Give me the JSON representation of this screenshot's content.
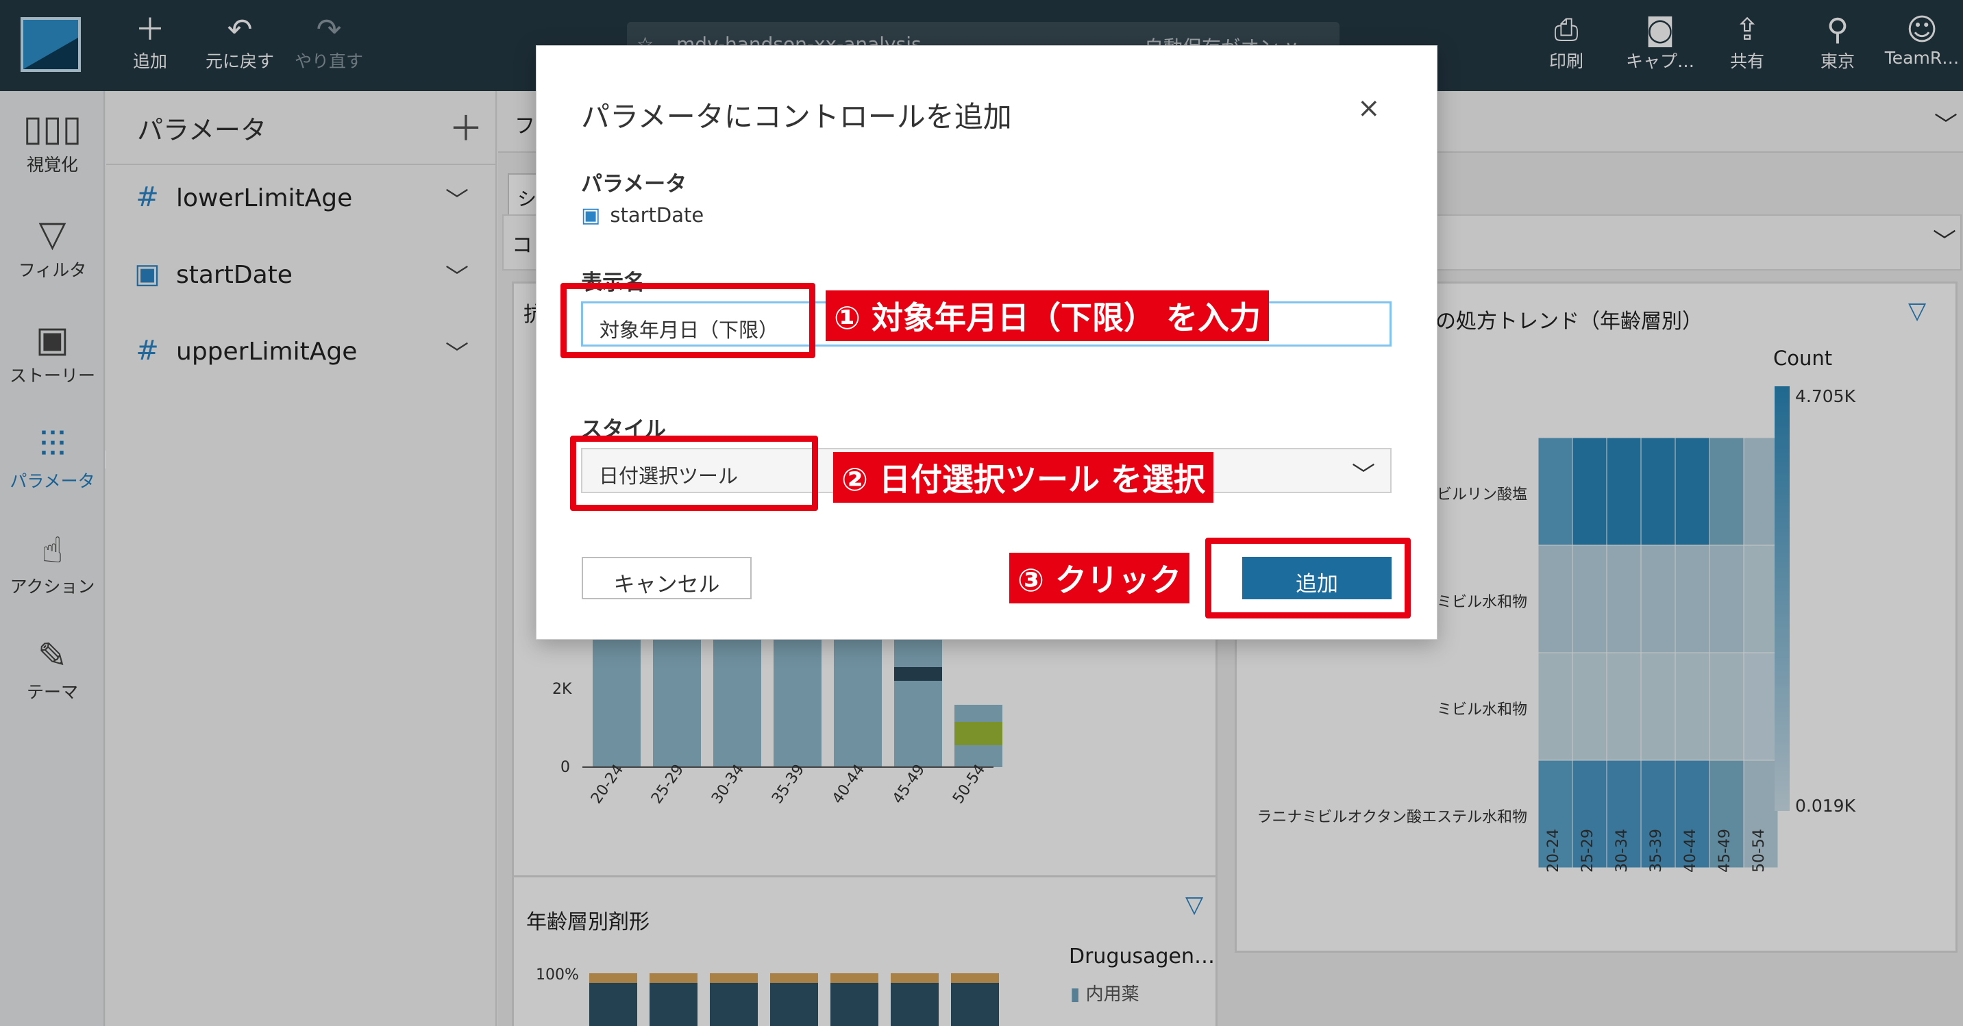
{
  "toolbar": {
    "add": "追加",
    "undo": "元に戻す",
    "redo": "やり直す",
    "analysis_name": "mdv-handson-xx-analysis",
    "autosave": "自動保存がオン ∨",
    "print": "印刷",
    "capture": "キャプ…",
    "share": "共有",
    "region": "東京",
    "user": "TeamR…"
  },
  "rail": {
    "items": [
      {
        "label": "視覚化",
        "icon": "bar-chart-icon"
      },
      {
        "label": "フィルタ",
        "icon": "filter-icon"
      },
      {
        "label": "ストーリー",
        "icon": "story-icon"
      },
      {
        "label": "パラメータ",
        "icon": "sliders-icon"
      },
      {
        "label": "アクション",
        "icon": "click-gear-icon"
      },
      {
        "label": "テーマ",
        "icon": "brush-icon"
      }
    ]
  },
  "params_panel": {
    "title": "パラメータ",
    "items": [
      {
        "name": "lowerLimitAge",
        "type": "number"
      },
      {
        "name": "startDate",
        "type": "date"
      },
      {
        "name": "upperLimitAge",
        "type": "number"
      }
    ]
  },
  "main": {
    "band1_text": "フ",
    "sheet_tab": "シ",
    "control_bar_text": "コ",
    "visual1_title": "抗",
    "visual2_title": "の処方トレンド（年齢層別）",
    "visual3_title": "年齢層別剤形",
    "legend3_title": "Drugusagen…",
    "legend3_item": "内用薬",
    "heat_count_label": "Count",
    "heat_max": "4.705K",
    "heat_min": "0.019K",
    "heat_rows": [
      "ビルリン酸塩",
      "ミビル水和物",
      "ミビル水和物",
      "ラニナミビルオクタン酸エステル水和物"
    ],
    "age_bins": [
      "20-24",
      "25-29",
      "30-34",
      "35-39",
      "40-44",
      "45-49",
      "50-54"
    ],
    "y_ticks_v1": [
      "2K",
      "0"
    ],
    "y_tick_v3": "100%"
  },
  "dialog": {
    "title": "パラメータにコントロールを追加",
    "param_label": "パラメータ",
    "param_value": "startDate",
    "display_name_label": "表示名",
    "display_name_value": "対象年月日（下限）",
    "style_label": "スタイル",
    "style_value": "日付選択ツール",
    "cancel": "キャンセル",
    "add": "追加"
  },
  "annotations": {
    "step1": "① 対象年月日（下限） を入力",
    "step2": "② 日付選択ツール を選択",
    "step3": "③ クリック"
  },
  "colors": {
    "topbar": "#253944",
    "accent": "#1f7dbf",
    "annotation": "#e60012",
    "primary_button": "#1c6c9e"
  }
}
